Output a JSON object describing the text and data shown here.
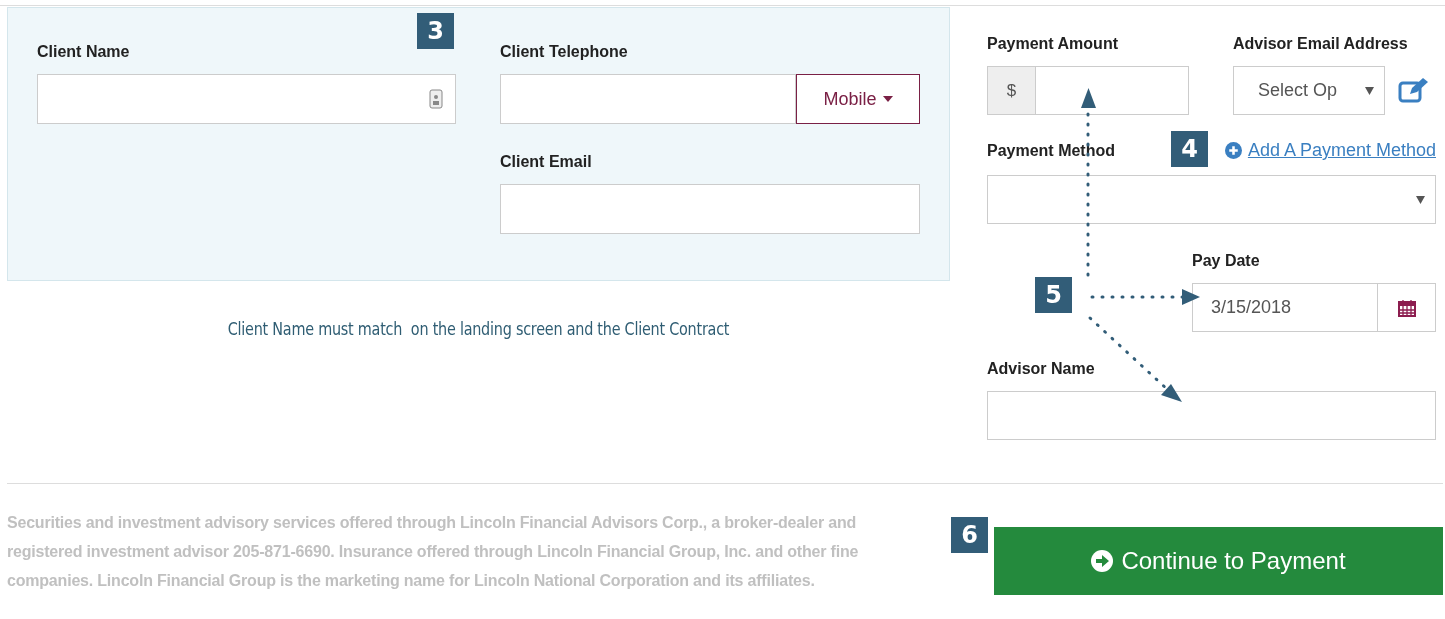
{
  "client_panel": {
    "client_name": {
      "label": "Client Name"
    },
    "client_telephone": {
      "label": "Client Telephone",
      "type_button": "Mobile"
    },
    "client_email": {
      "label": "Client Email"
    }
  },
  "helper_text": "Client Name must match  on the landing screen and the Client Contract",
  "payment": {
    "payment_amount": {
      "label": "Payment Amount",
      "prefix": "$"
    },
    "advisor_email": {
      "label": "Advisor Email Address",
      "value": "Select Op"
    },
    "payment_method": {
      "label": "Payment Method",
      "link": "Add A Payment Method"
    },
    "pay_date": {
      "label": "Pay Date",
      "value": "3/15/2018"
    },
    "advisor_name": {
      "label": "Advisor Name"
    }
  },
  "footer_text": "Securities and investment advisory services offered through Lincoln Financial Advisors Corp., a broker-dealer and registered investment advisor 205-871-6690. Insurance offered through Lincoln Financial Group, Inc. and other fine companies. Lincoln Financial Group is the marketing name for Lincoln National Corporation and its affiliates.",
  "continue_button": "Continue to Payment",
  "callouts": [
    {
      "label": "3"
    },
    {
      "label": "4"
    },
    {
      "label": "5"
    },
    {
      "label": "6"
    }
  ]
}
